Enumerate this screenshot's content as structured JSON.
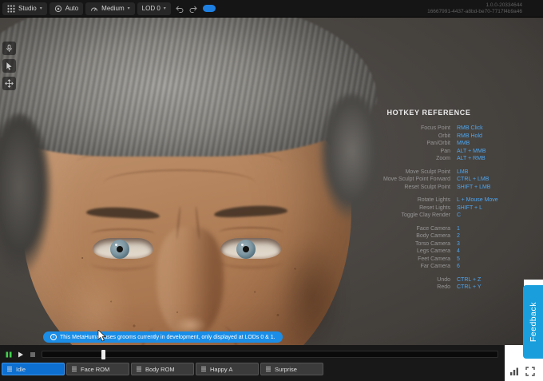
{
  "topbar": {
    "studio_label": "Studio",
    "auto_label": "Auto",
    "quality_label": "Medium",
    "lod_label": "LOD 0",
    "version_line1": "1.0.0-20334644",
    "version_line2": "16667991-4437-a8bd-be70-7717f4b9a46"
  },
  "icons": {
    "caret_down": "▾",
    "info": "i"
  },
  "colors": {
    "accent_blue": "#1e7fe0",
    "hotkey_value_blue": "#4da6f0",
    "tab_active_blue": "#0d6fd0",
    "toast_blue": "#1b8de6",
    "feedback_blue": "#1a9fdc",
    "play_green": "#3fd24a",
    "viewport_gray": "#46423e"
  },
  "hotkeys": {
    "title": "HOTKEY REFERENCE",
    "groups": [
      {
        "rows": [
          {
            "label": "Focus Point",
            "value": "RMB Click"
          },
          {
            "label": "Orbit",
            "value": "RMB Hold"
          },
          {
            "label": "Pan/Orbit",
            "value": "MMB"
          },
          {
            "label": "Pan",
            "value": "ALT + MMB"
          },
          {
            "label": "Zoom",
            "value": "ALT + RMB"
          }
        ]
      },
      {
        "rows": [
          {
            "label": "Move Sculpt Point",
            "value": "LMB"
          },
          {
            "label": "Move Sculpt Point Forward",
            "value": "CTRL + LMB"
          },
          {
            "label": "Reset Sculpt Point",
            "value": "SHIFT + LMB"
          }
        ]
      },
      {
        "rows": [
          {
            "label": "Rotate Lights",
            "value": "L + Mouse Move"
          },
          {
            "label": "Reset Lights",
            "value": "SHIFT + L"
          },
          {
            "label": "Toggle Clay Render",
            "value": "C"
          }
        ]
      },
      {
        "rows": [
          {
            "label": "Face Camera",
            "value": "1"
          },
          {
            "label": "Body Camera",
            "value": "2"
          },
          {
            "label": "Torso Camera",
            "value": "3"
          },
          {
            "label": "Legs Camera",
            "value": "4"
          },
          {
            "label": "Feet Camera",
            "value": "5"
          },
          {
            "label": "Far Camera",
            "value": "6"
          }
        ]
      },
      {
        "rows": [
          {
            "label": "Undo",
            "value": "CTRL + Z"
          },
          {
            "label": "Redo",
            "value": "CTRL + Y"
          }
        ]
      }
    ]
  },
  "toast": {
    "message": "This MetaHuman uses grooms currently in development, only displayed at LODs 0 & 1."
  },
  "timeline": {
    "progress_percent": 13,
    "tabs": [
      {
        "label": "Idle",
        "active": true
      },
      {
        "label": "Face ROM",
        "active": false
      },
      {
        "label": "Body ROM",
        "active": false
      },
      {
        "label": "Happy A",
        "active": false
      },
      {
        "label": "Surprise",
        "active": false
      }
    ]
  },
  "feedback": {
    "label": "Feedback"
  }
}
